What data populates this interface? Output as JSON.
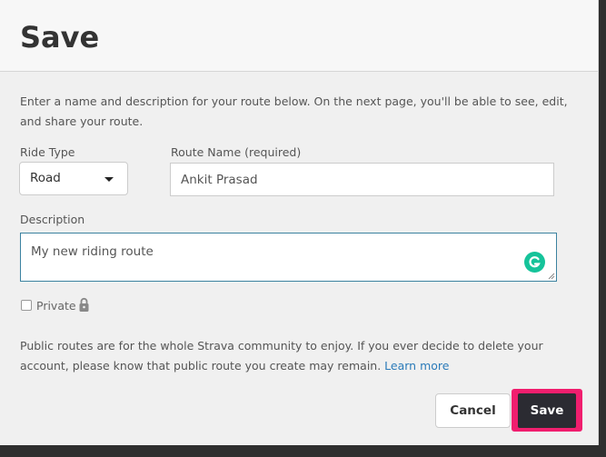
{
  "dialog": {
    "title": "Save",
    "intro": "Enter a name and description for your route below. On the next page, you'll be able to see, edit, and share your route."
  },
  "form": {
    "ride_type_label": "Ride Type",
    "ride_type_value": "Road",
    "route_name_label": "Route Name (required)",
    "route_name_value": "Ankit Prasad",
    "description_label": "Description",
    "description_value": "My new riding route",
    "private_label": "Private",
    "private_checked": false
  },
  "notice": {
    "text": "Public routes are for the whole Strava community to enjoy. If you ever decide to delete your account, please know that public route you create may remain.",
    "link": "Learn more"
  },
  "actions": {
    "cancel_label": "Cancel",
    "save_label": "Save"
  },
  "colors": {
    "save_bg": "#2b2b32",
    "highlight": "#f01e6e",
    "link": "#2b7bb9",
    "grammarly": "#15c39a"
  },
  "icons": {
    "dropdown": "chevron-down-icon",
    "lock": "lock-icon",
    "grammarly": "grammarly-icon"
  }
}
